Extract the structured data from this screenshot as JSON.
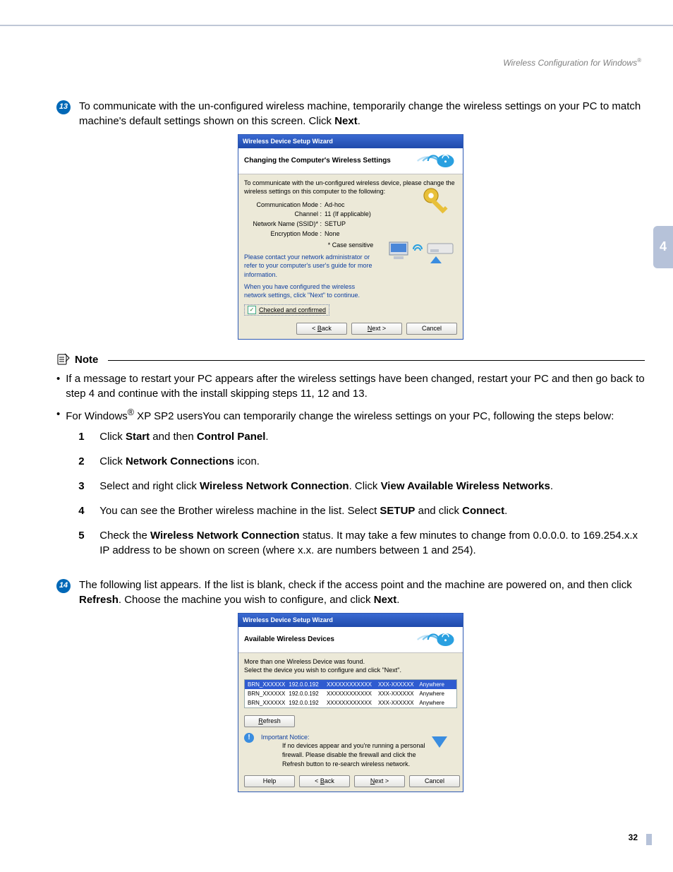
{
  "header": {
    "title_prefix": "Wireless Configuration for Windows",
    "title_suffix": "®"
  },
  "side_tab": "4",
  "page_number": "32",
  "step13": {
    "num": "13",
    "text_a": "To communicate with the un-configured wireless machine, temporarily change the wireless settings on your PC to match machine's default settings shown on this screen. Click ",
    "bold": "Next",
    "text_b": "."
  },
  "dialog1": {
    "window_title": "Wireless Device Setup Wizard",
    "heading": "Changing the Computer's Wireless Settings",
    "intro": "To communicate with the un-configured wireless device, please change the wireless settings on this computer to the following:",
    "rows": {
      "comm_label": "Communication Mode :",
      "comm_val": "Ad-hoc",
      "chan_label": "Channel :",
      "chan_val": "11   (If applicable)",
      "ssid_label": "Network Name (SSID)* :",
      "ssid_val": "SETUP",
      "enc_label": "Encryption Mode :",
      "enc_val": "None",
      "case": "* Case sensitive"
    },
    "contact": "Please contact your network administrator or refer to your computer's user's guide for more information.",
    "when_configured": "When you have configured the wireless network settings, click \"Next\" to continue.",
    "checked": "Checked and confirmed",
    "btn_back": "< Back",
    "btn_next": "Next >",
    "btn_cancel": "Cancel"
  },
  "note": {
    "title": "Note",
    "item1": "If a message to restart your PC appears after the wireless settings have been changed, restart your PC and then go back to step 4 and continue with the install skipping steps 11, 12 and 13.",
    "item2_a": "For Windows",
    "item2_b": " XP SP2 users",
    "item2_c": "You can temporarily change the wireless settings on your PC, following the steps below:",
    "s1": {
      "num": "1",
      "a": "Click ",
      "b1": "Start",
      "m": " and then ",
      "b2": "Control Panel",
      "z": "."
    },
    "s2": {
      "num": "2",
      "a": "Click ",
      "b1": "Network Connections",
      "z": " icon."
    },
    "s3": {
      "num": "3",
      "a": "Select and right click ",
      "b1": "Wireless Network Connection",
      "m": ". Click ",
      "b2": "View Available Wireless Networks",
      "z": "."
    },
    "s4": {
      "num": "4",
      "a": "You can see the Brother wireless machine in the list. Select ",
      "b1": "SETUP",
      "m": " and click ",
      "b2": "Connect",
      "z": "."
    },
    "s5": {
      "num": "5",
      "a": "Check the ",
      "b1": "Wireless Network Connection",
      "z": " status. It may take a few minutes to change from 0.0.0.0. to 169.254.x.x IP address to be shown on screen (where x.x. are numbers between 1 and 254)."
    }
  },
  "step14": {
    "num": "14",
    "a": "The following list appears. If the list is blank, check if the access point and the machine are powered on, and then click ",
    "b1": "Refresh",
    "m": ". Choose the machine you wish to configure, and click ",
    "b2": "Next",
    "z": "."
  },
  "dialog2": {
    "window_title": "Wireless Device Setup Wizard",
    "heading": "Available Wireless Devices",
    "intro1": "More than one Wireless Device was found.",
    "intro2": "Select the device you wish to configure and click \"Next\".",
    "devices": [
      {
        "name": "BRN_XXXXXX",
        "ip": "192.0.0.192",
        "mac": "XXXXXXXXXXXX",
        "printer": "XXX-XXXXXX",
        "loc": "Anywhere",
        "sel": true
      },
      {
        "name": "BRN_XXXXXX",
        "ip": "192.0.0.192",
        "mac": "XXXXXXXXXXXX",
        "printer": "XXX-XXXXXX",
        "loc": "Anywhere",
        "sel": false
      },
      {
        "name": "BRN_XXXXXX",
        "ip": "192.0.0.192",
        "mac": "XXXXXXXXXXXX",
        "printer": "XXX-XXXXXX",
        "loc": "Anywhere",
        "sel": false
      }
    ],
    "refresh": "Refresh",
    "important_label": "Important Notice:",
    "important_text": "If no devices appear and you're running a personal firewall. Please disable the firewall and click the Refresh button to re-search wireless network.",
    "btn_help": "Help",
    "btn_back": "< Back",
    "btn_next": "Next >",
    "btn_cancel": "Cancel"
  }
}
